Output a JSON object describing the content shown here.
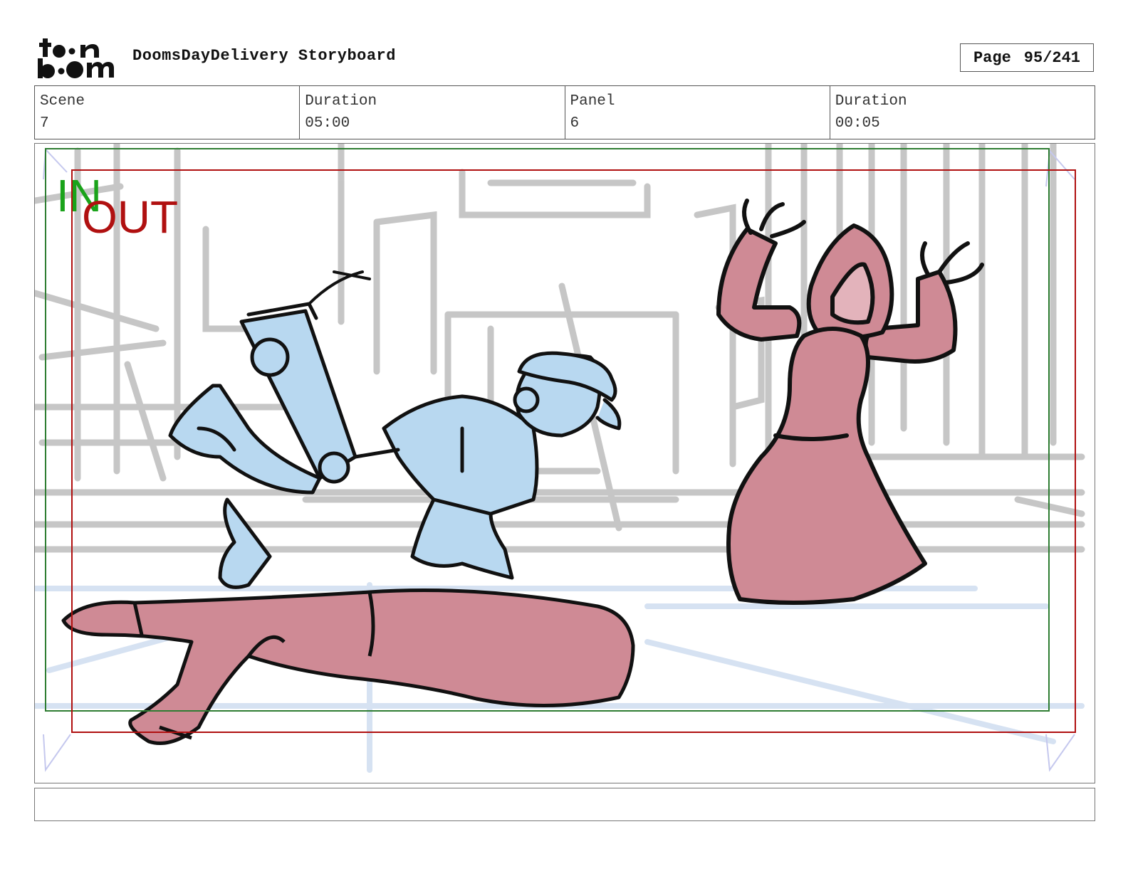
{
  "header": {
    "doc_title": "DoomsDayDelivery Storyboard",
    "page_label": "Page",
    "page_number": "95/241"
  },
  "info": {
    "scene_label": "Scene",
    "scene_value": "7",
    "scene_duration_label": "Duration",
    "scene_duration_value": "05:00",
    "panel_label": "Panel",
    "panel_value": "6",
    "panel_duration_label": "Duration",
    "panel_duration_value": "00:05"
  },
  "frame_marks": {
    "in_label": "IN",
    "out_label": "OUT",
    "in_color": "#1aa31a",
    "out_color": "#b01010"
  },
  "colors": {
    "character_blue": "#b8d8f0",
    "character_red": "#cf8a95",
    "background_sketch": "#bdbdbd",
    "ink": "#111111"
  },
  "icons": {
    "logo": "toon-boom-logo"
  }
}
